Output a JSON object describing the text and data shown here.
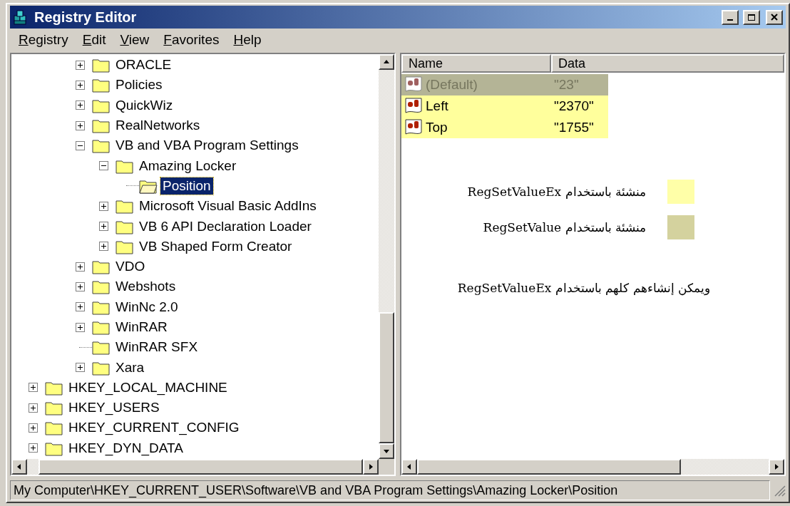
{
  "window": {
    "title": "Registry Editor"
  },
  "menu": [
    {
      "label": "Registry"
    },
    {
      "label": "Edit"
    },
    {
      "label": "View"
    },
    {
      "label": "Favorites"
    },
    {
      "label": "Help"
    }
  ],
  "tree": [
    {
      "children": [
        {
          "children": [
            {
              "label": "ORACLE",
              "kind": "branch",
              "expanded": false,
              "selected": false
            },
            {
              "label": "Policies",
              "kind": "branch",
              "expanded": false,
              "selected": false
            },
            {
              "label": "QuickWiz",
              "kind": "branch",
              "expanded": false,
              "selected": false
            },
            {
              "label": "RealNetworks",
              "kind": "branch",
              "expanded": false,
              "selected": false
            },
            {
              "label": "VB and VBA Program Settings",
              "kind": "branch",
              "expanded": true,
              "selected": false,
              "children": [
                {
                  "label": "Amazing Locker",
                  "kind": "branch",
                  "expanded": true,
                  "selected": false,
                  "children": [
                    {
                      "label": "Position",
                      "kind": "leaf",
                      "selected": true
                    }
                  ]
                },
                {
                  "label": "Microsoft Visual Basic AddIns",
                  "kind": "branch",
                  "expanded": false,
                  "selected": false
                },
                {
                  "label": "VB 6 API Declaration Loader",
                  "kind": "branch",
                  "expanded": false,
                  "selected": false
                },
                {
                  "label": "VB Shaped Form Creator",
                  "kind": "branch",
                  "expanded": false,
                  "selected": false
                }
              ]
            },
            {
              "label": "VDO",
              "kind": "branch",
              "expanded": false,
              "selected": false
            },
            {
              "label": "Webshots",
              "kind": "branch",
              "expanded": false,
              "selected": false
            },
            {
              "label": "WinNc 2.0",
              "kind": "branch",
              "expanded": false,
              "selected": false
            },
            {
              "label": "WinRAR",
              "kind": "branch",
              "expanded": false,
              "selected": false
            },
            {
              "label": "WinRAR SFX",
              "kind": "leaf",
              "selected": false
            },
            {
              "label": "Xara",
              "kind": "branch",
              "expanded": false,
              "selected": false
            }
          ]
        }
      ]
    },
    {
      "label": "HKEY_LOCAL_MACHINE",
      "kind": "branch",
      "expanded": false,
      "selected": false
    },
    {
      "label": "HKEY_USERS",
      "kind": "branch",
      "expanded": false,
      "selected": false
    },
    {
      "label": "HKEY_CURRENT_CONFIG",
      "kind": "branch",
      "expanded": false,
      "selected": false
    },
    {
      "label": "HKEY_DYN_DATA",
      "kind": "branch",
      "expanded": false,
      "selected": false
    }
  ],
  "values": {
    "columns": [
      "Name",
      "Data"
    ],
    "rows": [
      {
        "name": "(Default)",
        "data": "\"23\"",
        "dimmed": true,
        "color": "#b4b496"
      },
      {
        "name": "Left",
        "data": "\"2370\"",
        "dimmed": false,
        "color": "#ffff9c"
      },
      {
        "name": "Top",
        "data": "\"1755\"",
        "dimmed": false,
        "color": "#ffff9c"
      }
    ]
  },
  "legend": [
    {
      "text": "منشئة باستخدام RegSetValueEx",
      "color": "#ffffa8"
    },
    {
      "text": "منشئة باستخدام RegSetValue",
      "color": "#d4d29e"
    }
  ],
  "note": "ويمكن إنشاءهم كلهم باستخدام RegSetValueEx",
  "status_bar": "My Computer\\HKEY_CURRENT_USER\\Software\\VB and VBA Program Settings\\Amazing Locker\\Position"
}
